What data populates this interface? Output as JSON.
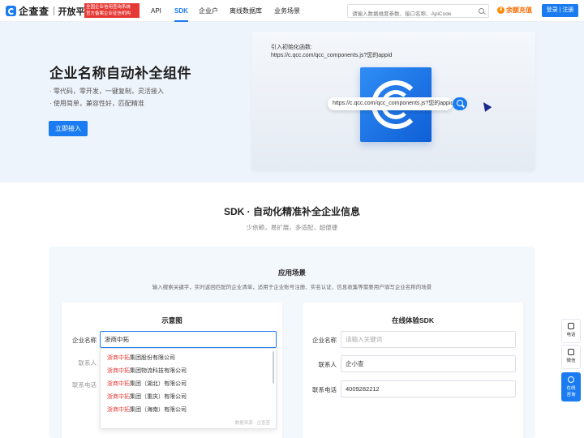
{
  "header": {
    "logo_text": "企查查",
    "logo_sub": "开放平台",
    "badge_line1": "全国企业信用查询系统",
    "badge_line2": "官方备案企业征信机构",
    "nav": [
      "API",
      "SDK",
      "企业户",
      "离线数据库",
      "业务场景"
    ],
    "active_nav": "SDK",
    "search_placeholder": "请输入数据维度参数、接口名称、ApiCode",
    "recharge_label": "余额充值",
    "login_label": "登录 | 注册"
  },
  "hero": {
    "title": "企业名称自动补全组件",
    "bullets": [
      "· 零代码，零开发，一键复制，灵活接入",
      "· 使用简单，兼容性好，匹配精准"
    ],
    "cta_label": "立即接入",
    "demo_caption_line1": "引入初始化函数:",
    "demo_caption_line2": "https://c.qcc.com/qcc_components.js?您的appid",
    "demo_url": "https://c.qcc.com/qcc_components.js?您的appid"
  },
  "section": {
    "title": "SDK · 自动化精准补全企业信息",
    "subtitle": "少依赖，易扩展，多适配，超便捷",
    "scene_title": "应用场景",
    "scene_desc": "输入搜索关键字，实时返回匹配的企业清单，适用于企业账号注册、实名认证、信息收集等需要用户填写企业名称的场景"
  },
  "left_panel": {
    "title": "示意图",
    "company_label": "企业名称",
    "company_value": "浙商中拓",
    "contact_label": "联系人",
    "phone_label": "联系电话",
    "suggestions": [
      {
        "hl": "浙商中拓",
        "rest": "集团股份有限公司"
      },
      {
        "hl": "浙商中拓",
        "rest": "集团物流科技有限公司"
      },
      {
        "hl": "浙商中拓",
        "rest": "集团（湖北）有限公司"
      },
      {
        "hl": "浙商中拓",
        "rest": "集团（重庆）有限公司"
      },
      {
        "hl": "浙商中拓",
        "rest": "集团（海南）有限公司"
      }
    ],
    "dropdown_footer": "数据来源 · 企查查"
  },
  "right_panel": {
    "title": "在线体验SDK",
    "company_label": "企业名称",
    "company_placeholder": "请输入关键词",
    "contact_label": "联系人",
    "contact_value": "企小查",
    "phone_label": "联系电话",
    "phone_value": "4009282212"
  },
  "side_float": {
    "phone": "电话",
    "wechat": "微信",
    "online_line1": "在线",
    "online_line2": "咨询"
  },
  "colors": {
    "brand": "#1a7cf0",
    "badge": "#e53935",
    "recharge": "#ff6a00",
    "highlight": "#e53935"
  }
}
